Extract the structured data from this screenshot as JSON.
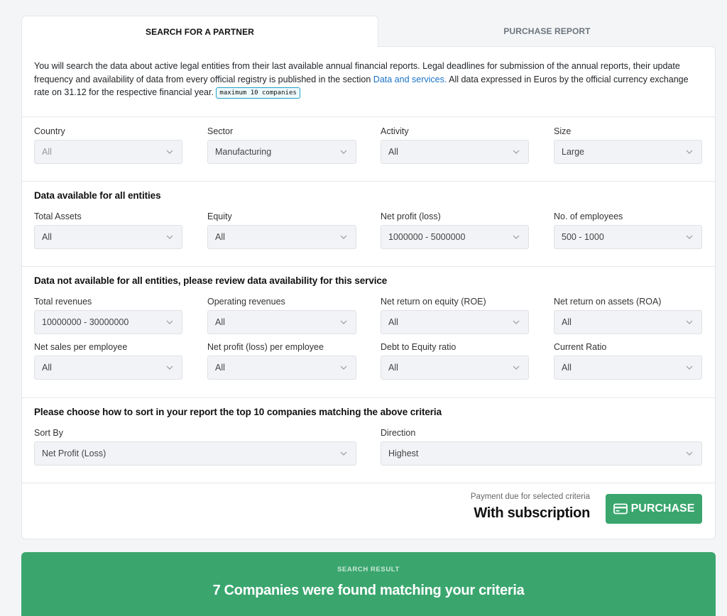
{
  "tabs": {
    "search": "SEARCH FOR A PARTNER",
    "purchase": "PURCHASE REPORT"
  },
  "intro": {
    "text_before_link": "You will search the data about active legal entities from their last available annual financial reports. Legal deadlines for submission of the annual reports, their update frequency and availability of data from every official registry is published in the section ",
    "link": "Data and services.",
    "text_after_link": " All data expressed in Euros by the official currency exchange rate on 31.12 for the respective financial year. ",
    "badge": "maximum 10 companies"
  },
  "filters_basic": [
    {
      "label": "Country",
      "value": "All"
    },
    {
      "label": "Sector",
      "value": "Manufacturing"
    },
    {
      "label": "Activity",
      "value": "All"
    },
    {
      "label": "Size",
      "value": "Large"
    }
  ],
  "section_all": {
    "title": "Data available for all entities",
    "fields": [
      {
        "label": "Total Assets",
        "value": "All"
      },
      {
        "label": "Equity",
        "value": "All"
      },
      {
        "label": "Net profit (loss)",
        "value": "1000000 - 5000000"
      },
      {
        "label": "No. of employees",
        "value": "500 - 1000"
      }
    ]
  },
  "section_partial": {
    "title": "Data not available for all entities, please review data availability for this service",
    "fields": [
      {
        "label": "Total revenues",
        "value": "10000000 - 30000000"
      },
      {
        "label": "Operating revenues",
        "value": "All"
      },
      {
        "label": "Net return on equity (ROE)",
        "value": "All"
      },
      {
        "label": "Net return on assets (ROA)",
        "value": "All"
      },
      {
        "label": "Net sales per employee",
        "value": "All"
      },
      {
        "label": "Net profit (loss) per employee",
        "value": "All"
      },
      {
        "label": "Debt to Equity ratio",
        "value": "All"
      },
      {
        "label": "Current Ratio",
        "value": "All"
      }
    ]
  },
  "section_sort": {
    "title": "Please choose how to sort in your report the top 10 companies matching the above criteria",
    "sort_by": {
      "label": "Sort By",
      "value": "Net Profit (Loss)"
    },
    "direction": {
      "label": "Direction",
      "value": "Highest"
    }
  },
  "payment": {
    "label": "Payment due for selected criteria",
    "value": "With subscription",
    "button": "PURCHASE"
  },
  "result": {
    "kicker": "SEARCH RESULT",
    "headline": "7 Companies were found matching your criteria"
  },
  "colors": {
    "accent_green": "#3aa66e",
    "link_blue": "#1a73c8"
  }
}
